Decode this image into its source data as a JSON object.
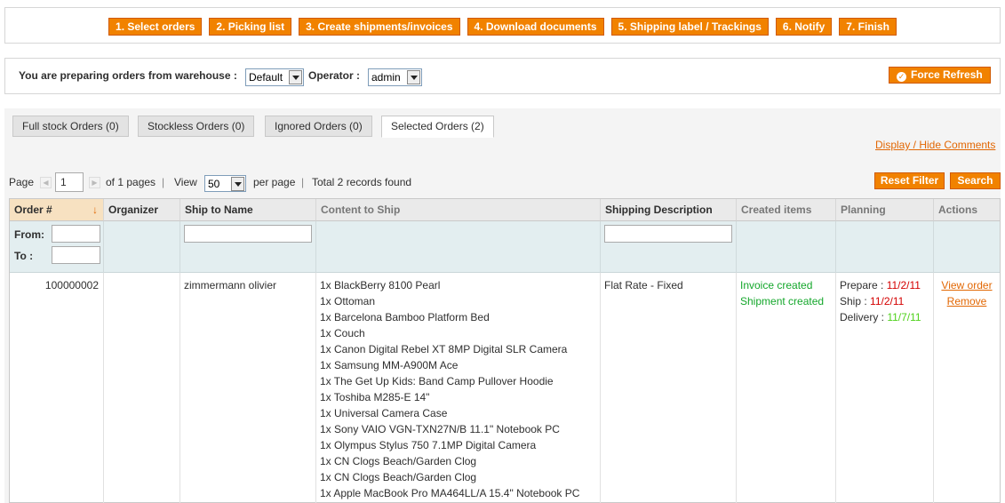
{
  "steps": [
    "1. Select orders",
    "2. Picking list",
    "3. Create shipments/invoices",
    "4. Download documents",
    "5. Shipping label / Trackings",
    "6. Notify",
    "7. Finish"
  ],
  "warehouse": {
    "label": "You are preparing orders from warehouse :",
    "value": "Default",
    "operator_label": "Operator :",
    "operator_value": "admin",
    "force_refresh": "Force Refresh"
  },
  "tabs": [
    "Full stock Orders (0)",
    "Stockless Orders (0)",
    "Ignored Orders (0)",
    "Selected Orders (2)"
  ],
  "display_hide_comments": "Display / Hide Comments",
  "pager": {
    "page_label": "Page",
    "page_value": "1",
    "of_pages": "of 1 pages",
    "view_label": "View",
    "view_value": "50",
    "per_page": "per page",
    "total": "Total 2 records found"
  },
  "buttons": {
    "reset_filter": "Reset Filter",
    "search": "Search"
  },
  "columns": [
    "Order #",
    "Organizer",
    "Ship to Name",
    "Content to Ship",
    "Shipping Description",
    "Created items",
    "Planning",
    "Actions"
  ],
  "filters": {
    "from": "From:",
    "to": "To :"
  },
  "row": {
    "order_number": "100000002",
    "ship_to_name": "zimmermann olivier",
    "content": [
      "1x BlackBerry 8100 Pearl",
      "1x Ottoman",
      "1x Barcelona Bamboo Platform Bed",
      "1x Couch",
      "1x Canon Digital Rebel XT 8MP Digital SLR Camera",
      "1x Samsung MM-A900M Ace",
      "1x The Get Up Kids: Band Camp Pullover Hoodie",
      "1x Toshiba M285-E 14\"",
      "1x Universal Camera Case",
      "1x Sony VAIO VGN-TXN27N/B 11.1\" Notebook PC",
      "1x Olympus Stylus 750 7.1MP Digital Camera",
      "1x CN Clogs Beach/Garden Clog",
      "1x CN Clogs Beach/Garden Clog",
      "1x Apple MacBook Pro MA464LL/A 15.4\" Notebook PC"
    ],
    "shipping_description": "Flat Rate - Fixed",
    "created_items": [
      "Invoice created",
      "Shipment created"
    ],
    "planning": {
      "prepare_label": "Prepare : ",
      "prepare_date": "11/2/11",
      "ship_label": "Ship : ",
      "ship_date": "11/2/11",
      "delivery_label": "Delivery : ",
      "delivery_date": "11/7/11"
    },
    "actions": {
      "view_order": "View order",
      "remove": "Remove"
    }
  }
}
